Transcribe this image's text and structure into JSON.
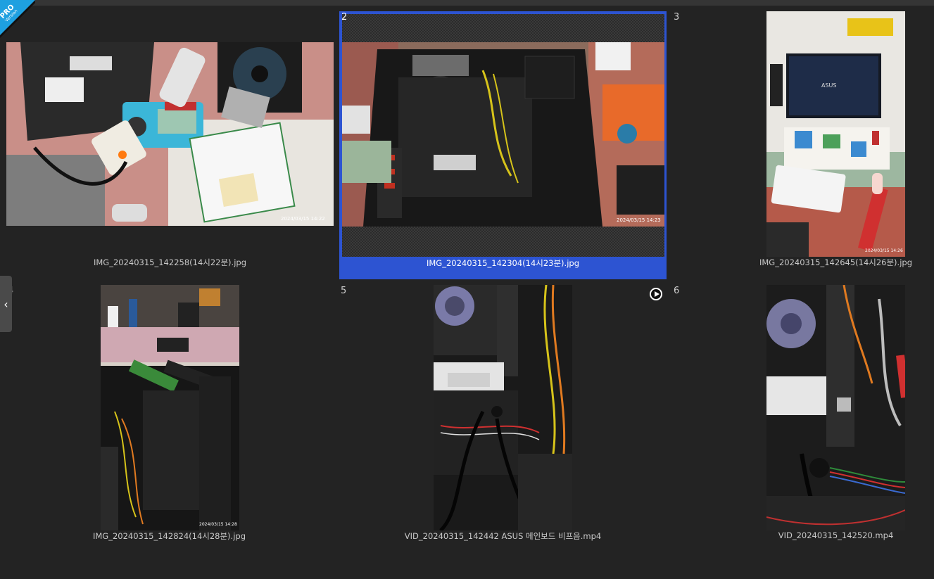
{
  "badge": {
    "line1": "PRO",
    "line2": "Version"
  },
  "nav": {
    "prev_glyph": "‹"
  },
  "items": [
    {
      "index": "",
      "caption": "IMG_20240315_142258(14시22분).jpg",
      "stamp": "2024/03/15  14:22"
    },
    {
      "index": "2",
      "caption": "IMG_20240315_142304(14시23분).jpg",
      "stamp": "2024/03/15  14:23",
      "selected": true
    },
    {
      "index": "3",
      "caption": "IMG_20240315_142645(14시26분).jpg",
      "stamp": "2024/03/15  14:26"
    },
    {
      "index": "4",
      "caption": "IMG_20240315_142824(14시28분).jpg",
      "stamp": "2024/03/15  14:28"
    },
    {
      "index": "5",
      "caption": "VID_20240315_142442 ASUS 메인보드 비프음.mp4"
    },
    {
      "index": "6",
      "caption": "VID_20240315_142520.mp4"
    }
  ],
  "colors": {
    "background": "#232323",
    "selection": "#2d54d2",
    "badge": "#1ea0e0"
  }
}
